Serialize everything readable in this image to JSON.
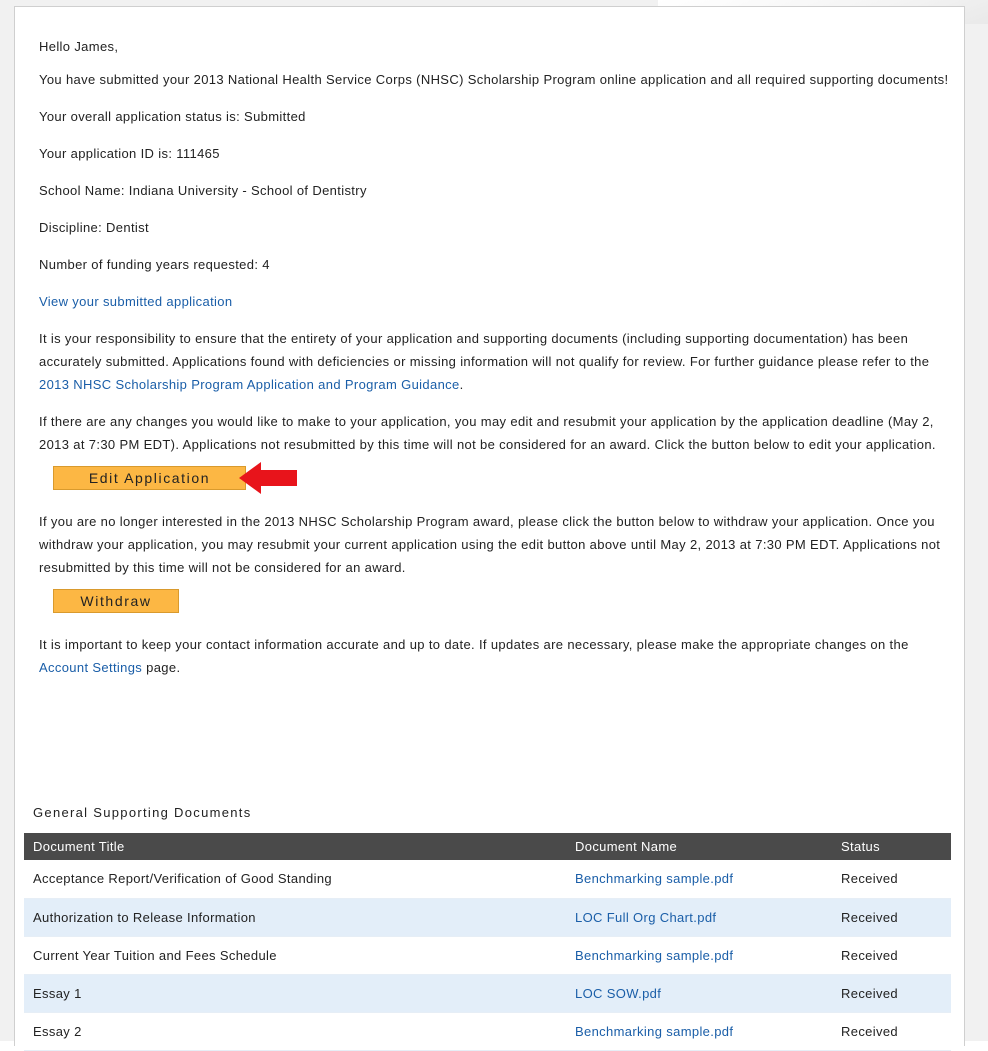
{
  "greeting": "Hello James,",
  "submitted_msg": "You have submitted your 2013 National Health Service Corps (NHSC) Scholarship Program online application and all required supporting documents!",
  "status_line": "Your overall application status is: Submitted",
  "app_id_line": "Your application ID is: 111465",
  "school_line": "School Name: Indiana University - School of Dentistry",
  "discipline_line": "Discipline: Dentist",
  "funding_line": "Number of funding years requested: 4",
  "view_link": "View your submitted application",
  "responsibility": {
    "text": "It is your responsibility to ensure that the entirety of your application and supporting documents (including supporting documentation) has been accurately submitted. Applications found with deficiencies or missing information will not qualify for review. For further guidance please refer to the ",
    "link": "2013 NHSC Scholarship Program Application and Program Guidance",
    "end": "."
  },
  "changes_text": "If there are any changes you would like to make to your application, you may edit and resubmit your application by the application deadline (May 2, 2013 at 7:30 PM EDT). Applications not resubmitted by this time will not be considered for an award. Click the button below to edit your application.",
  "edit_button": "Edit Application",
  "withdraw_text": "If you are no longer interested in the 2013 NHSC Scholarship Program award, please click the button below to withdraw your application. Once you withdraw your application, you may resubmit your current application using the edit button above until May 2, 2013 at 7:30 PM EDT. Applications not resubmitted by this time will not be considered for an award.",
  "withdraw_button": "Withdraw",
  "contact": {
    "text": "It is important to keep your contact information accurate and up to date. If updates are necessary, please make the appropriate changes on the ",
    "link": "Account Settings",
    "end": " page."
  },
  "docs_section_title": "General Supporting Documents",
  "docs_table": {
    "headers": [
      "Document Title",
      "Document Name",
      "Status"
    ],
    "rows": [
      {
        "title": "Acceptance Report/Verification of Good Standing",
        "name": "Benchmarking sample.pdf",
        "status": "Received"
      },
      {
        "title": "Authorization to Release Information",
        "name": "LOC Full Org Chart.pdf",
        "status": "Received"
      },
      {
        "title": "Current Year Tuition and Fees Schedule",
        "name": "Benchmarking sample.pdf",
        "status": "Received"
      },
      {
        "title": "Essay 1",
        "name": "LOC SOW.pdf",
        "status": "Received"
      },
      {
        "title": "Essay 2",
        "name": "Benchmarking sample.pdf",
        "status": "Received"
      }
    ]
  },
  "colors": {
    "button": "#fcb744",
    "link": "#1a5ea8",
    "header_bg": "#4a4a4a",
    "alt_row": "#e3eef9",
    "arrow": "#e8141b"
  }
}
